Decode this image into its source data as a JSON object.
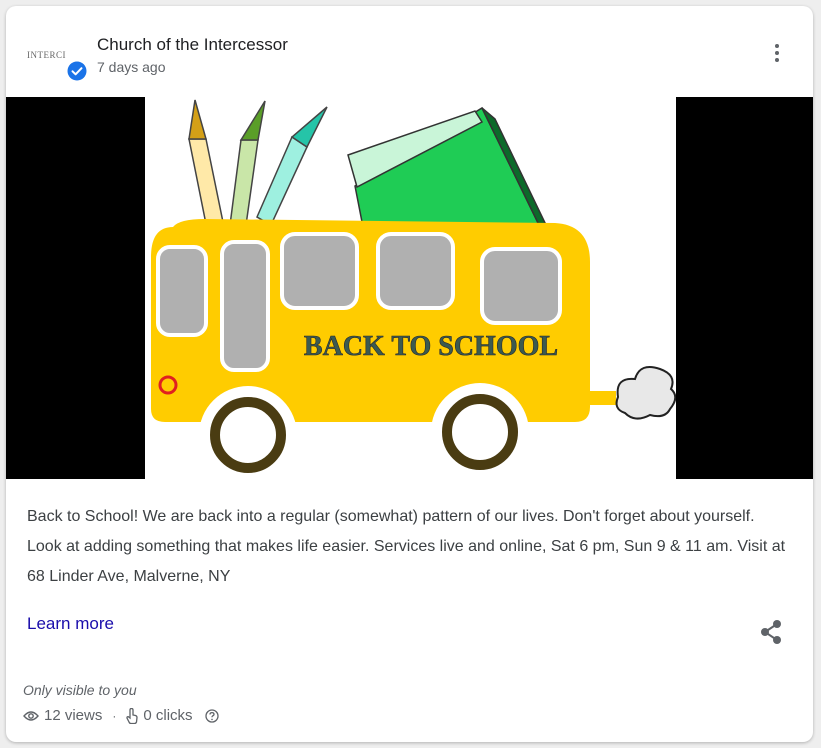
{
  "header": {
    "account_name": "Church of the Intercessor",
    "posted_time": "7 days ago",
    "avatar_text": "INTERCI"
  },
  "image": {
    "headline": "BACK TO SCHOOL"
  },
  "post": {
    "body": "Back to School! We are back into a regular (somewhat) pattern of our lives. Don't forget about yourself. Look at adding something that makes life easier.  Services live and online, Sat 6 pm, Sun 9 & 11 am.  Visit at 68 Linder Ave, Malverne, NY",
    "cta_label": "Learn more"
  },
  "footer": {
    "visibility": "Only visible to you",
    "views": "12 views",
    "clicks": "0 clicks"
  },
  "colors": {
    "bus": "#ffcc00",
    "link": "#1a0dab",
    "verified": "#1a73e8"
  },
  "icons": [
    "verified-badge-icon",
    "more-vert-icon",
    "share-icon",
    "eye-icon",
    "click-icon",
    "help-icon"
  ]
}
